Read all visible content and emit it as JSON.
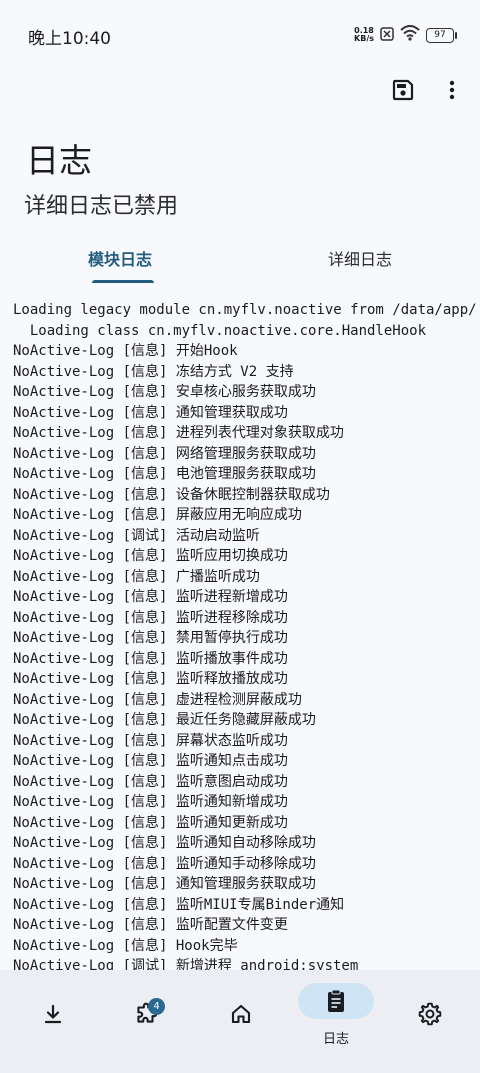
{
  "status_bar": {
    "time": "晚上10:40",
    "net_speed_value": "0.18",
    "net_speed_unit": "KB/s",
    "battery": "97"
  },
  "toolbar": {
    "save_icon": "save-icon",
    "more_icon": "more-vert-icon"
  },
  "header": {
    "title": "日志",
    "subtitle": "详细日志已禁用"
  },
  "tabs": [
    {
      "label": "模块日志",
      "active": true
    },
    {
      "label": "详细日志",
      "active": false
    }
  ],
  "log_lines": [
    "Loading legacy module cn.myflv.noactive from /data/app/",
    "  Loading class cn.myflv.noactive.core.HandleHook",
    "NoActive-Log [信息] 开始Hook",
    "NoActive-Log [信息] 冻结方式 V2 支持",
    "NoActive-Log [信息] 安卓核心服务获取成功",
    "NoActive-Log [信息] 通知管理获取成功",
    "NoActive-Log [信息] 进程列表代理对象获取成功",
    "NoActive-Log [信息] 网络管理服务获取成功",
    "NoActive-Log [信息] 电池管理服务获取成功",
    "NoActive-Log [信息] 设备休眠控制器获取成功",
    "NoActive-Log [信息] 屏蔽应用无响应成功",
    "NoActive-Log [调试] 活动启动监听",
    "NoActive-Log [信息] 监听应用切换成功",
    "NoActive-Log [信息] 广播监听成功",
    "NoActive-Log [信息] 监听进程新增成功",
    "NoActive-Log [信息] 监听进程移除成功",
    "NoActive-Log [信息] 禁用暂停执行成功",
    "NoActive-Log [信息] 监听播放事件成功",
    "NoActive-Log [信息] 监听释放播放成功",
    "NoActive-Log [信息] 虚进程检测屏蔽成功",
    "NoActive-Log [信息] 最近任务隐藏屏蔽成功",
    "NoActive-Log [信息] 屏幕状态监听成功",
    "NoActive-Log [信息] 监听通知点击成功",
    "NoActive-Log [信息] 监听意图启动成功",
    "NoActive-Log [信息] 监听通知新增成功",
    "NoActive-Log [信息] 监听通知更新成功",
    "NoActive-Log [信息] 监听通知自动移除成功",
    "NoActive-Log [信息] 监听通知手动移除成功",
    "NoActive-Log [信息] 通知管理服务获取成功",
    "NoActive-Log [信息] 监听MIUI专属Binder通知",
    "NoActive-Log [信息] 监听配置文件变更",
    "NoActive-Log [信息] Hook完毕",
    "NoActive-Log [调试] 新增进程 android:system"
  ],
  "bottom_nav": {
    "items": [
      {
        "icon": "download-icon",
        "label": ""
      },
      {
        "icon": "extension-icon",
        "label": "",
        "badge": "4"
      },
      {
        "icon": "home-icon",
        "label": ""
      },
      {
        "icon": "log-clipboard-icon",
        "label": "日志",
        "active": true
      },
      {
        "icon": "settings-icon",
        "label": ""
      }
    ]
  },
  "colors": {
    "accent": "#235c7e",
    "background": "#f8f9fc",
    "nav_background": "#eceef3",
    "nav_pill": "#cfe5f5"
  }
}
